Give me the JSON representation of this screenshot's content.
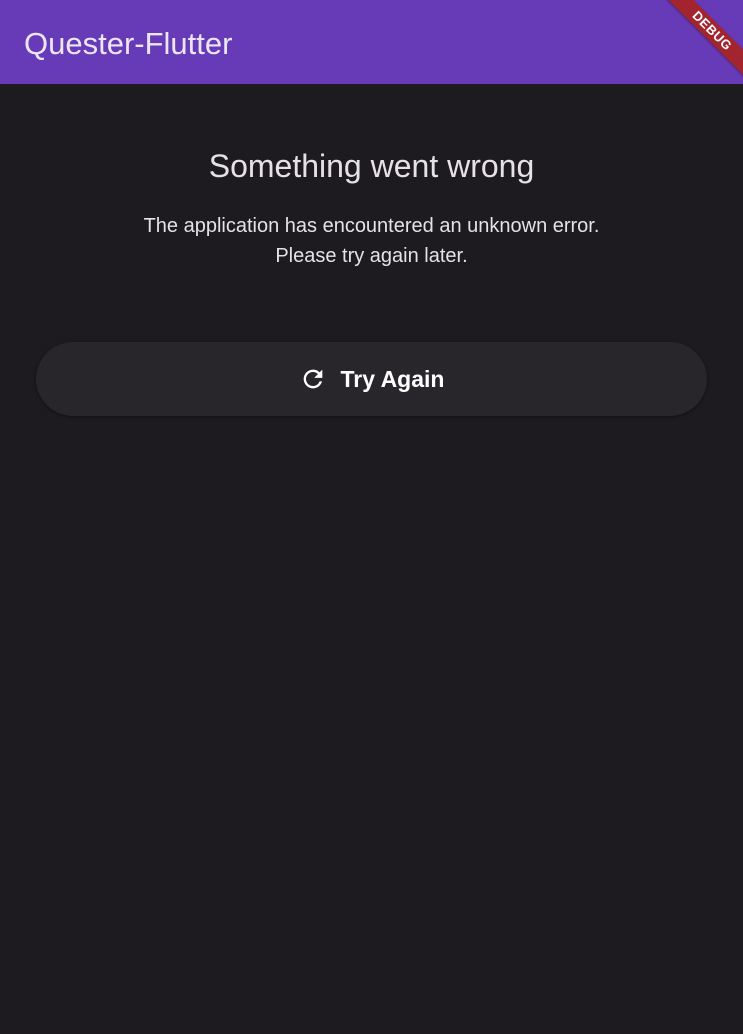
{
  "app_bar": {
    "title": "Quester-Flutter",
    "debug_label": "DEBUG",
    "color": "#673ab7"
  },
  "error": {
    "title": "Something went wrong",
    "message_line1": "The application has encountered an unknown error.",
    "message_line2": "Please try again later."
  },
  "retry_button": {
    "label": "Try Again",
    "icon": "refresh-icon"
  },
  "colors": {
    "background": "#1d1b1f",
    "button_background": "#28262b",
    "debug_banner": "#a2242f"
  }
}
